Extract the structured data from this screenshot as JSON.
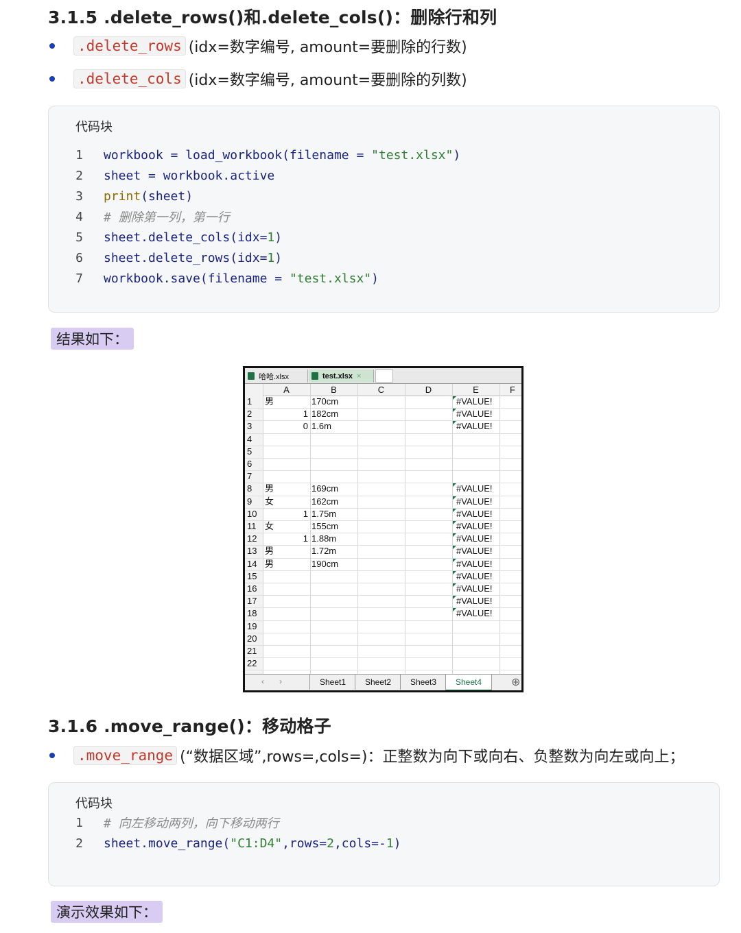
{
  "section1": {
    "heading": "3.1.5 .delete_rows()和.delete_cols()：删除行和列",
    "bullets": [
      {
        "code": ".delete_rows",
        "text": "(idx=数字编号, amount=要删除的行数)"
      },
      {
        "code": ".delete_cols",
        "text": "(idx=数字编号, amount=要删除的列数)"
      }
    ],
    "code_title": "代码块",
    "code_lines": [
      {
        "n": "1",
        "parts": [
          [
            "n",
            "workbook = load_workbook(filename = "
          ],
          [
            "s",
            "\"test.xlsx\""
          ],
          [
            "n",
            ")"
          ]
        ]
      },
      {
        "n": "2",
        "parts": [
          [
            "n",
            "sheet = workbook.active"
          ]
        ]
      },
      {
        "n": "3",
        "parts": [
          [
            "k",
            "print"
          ],
          [
            "n",
            "(sheet)"
          ]
        ]
      },
      {
        "n": "4",
        "parts": [
          [
            "c",
            "# 删除第一列，第一行"
          ]
        ]
      },
      {
        "n": "5",
        "parts": [
          [
            "n",
            "sheet.delete_cols(idx="
          ],
          [
            "s",
            "1"
          ],
          [
            "n",
            ")"
          ]
        ]
      },
      {
        "n": "6",
        "parts": [
          [
            "n",
            "sheet.delete_rows(idx="
          ],
          [
            "s",
            "1"
          ],
          [
            "n",
            ")"
          ]
        ]
      },
      {
        "n": "7",
        "parts": [
          [
            "n",
            "workbook.save(filename = "
          ],
          [
            "s",
            "\"test.xlsx\""
          ],
          [
            "n",
            ")"
          ]
        ]
      }
    ],
    "result_label": "结果如下："
  },
  "excel": {
    "file_tabs": [
      "哈哈.xlsx",
      "test.xlsx"
    ],
    "close_mark": "×",
    "columns": [
      "A",
      "B",
      "C",
      "D",
      "E",
      "F"
    ],
    "rows": [
      {
        "r": "1",
        "a": "男",
        "a_num": "",
        "b": "170cm",
        "e": "#VALUE!"
      },
      {
        "r": "2",
        "a": "",
        "a_num": "1",
        "b": "182cm",
        "e": "#VALUE!"
      },
      {
        "r": "3",
        "a": "",
        "a_num": "0",
        "b": "1.6m",
        "e": "#VALUE!"
      },
      {
        "r": "4",
        "a": "",
        "a_num": "",
        "b": "",
        "e": ""
      },
      {
        "r": "5",
        "a": "",
        "a_num": "",
        "b": "",
        "e": ""
      },
      {
        "r": "6",
        "a": "",
        "a_num": "",
        "b": "",
        "e": ""
      },
      {
        "r": "7",
        "a": "",
        "a_num": "",
        "b": "",
        "e": ""
      },
      {
        "r": "8",
        "a": "男",
        "a_num": "",
        "b": "169cm",
        "e": "#VALUE!"
      },
      {
        "r": "9",
        "a": "女",
        "a_num": "",
        "b": "162cm",
        "e": "#VALUE!"
      },
      {
        "r": "10",
        "a": "",
        "a_num": "1",
        "b": "1.75m",
        "e": "#VALUE!"
      },
      {
        "r": "11",
        "a": "女",
        "a_num": "",
        "b": "155cm",
        "e": "#VALUE!"
      },
      {
        "r": "12",
        "a": "",
        "a_num": "1",
        "b": "1.88m",
        "e": "#VALUE!"
      },
      {
        "r": "13",
        "a": "男",
        "a_num": "",
        "b": "1.72m",
        "e": "#VALUE!"
      },
      {
        "r": "14",
        "a": "男",
        "a_num": "",
        "b": "190cm",
        "e": "#VALUE!"
      },
      {
        "r": "15",
        "a": "",
        "a_num": "",
        "b": "",
        "e": "#VALUE!"
      },
      {
        "r": "16",
        "a": "",
        "a_num": "",
        "b": "",
        "e": "#VALUE!"
      },
      {
        "r": "17",
        "a": "",
        "a_num": "",
        "b": "",
        "e": "#VALUE!"
      },
      {
        "r": "18",
        "a": "",
        "a_num": "",
        "b": "",
        "e": "#VALUE!"
      },
      {
        "r": "19",
        "a": "",
        "a_num": "",
        "b": "",
        "e": ""
      },
      {
        "r": "20",
        "a": "",
        "a_num": "",
        "b": "",
        "e": ""
      },
      {
        "r": "21",
        "a": "",
        "a_num": "",
        "b": "",
        "e": ""
      },
      {
        "r": "22",
        "a": "",
        "a_num": "",
        "b": "",
        "e": ""
      }
    ],
    "nav_prev": "‹",
    "nav_next": "›",
    "sheet_tabs": [
      "Sheet1",
      "Sheet2",
      "Sheet3",
      "Sheet4"
    ],
    "active_sheet": "Sheet4",
    "add_sheet": "⊕"
  },
  "section2": {
    "heading": "3.1.6 .move_range()：移动格子",
    "bullet": {
      "code": ".move_range",
      "text": "(“数据区域”,rows=,cols=)：正整数为向下或向右、负整数为向左或向上；"
    },
    "code_title": "代码块",
    "code_lines": [
      {
        "n": "1",
        "parts": [
          [
            "c",
            "# 向左移动两列，向下移动两行"
          ]
        ]
      },
      {
        "n": "2",
        "parts": [
          [
            "n",
            "sheet.move_range("
          ],
          [
            "s",
            "\"C1:D4\""
          ],
          [
            "n",
            ",rows="
          ],
          [
            "s",
            "2"
          ],
          [
            "n",
            ",cols=-"
          ],
          [
            "s",
            "1"
          ],
          [
            "n",
            ")"
          ]
        ]
      }
    ],
    "demo_label": "演示效果如下："
  },
  "colors": {
    "bullet": "#1a3fb0",
    "inline_code": "#c0392b",
    "tag_bg": "#d9ccf2",
    "code_bg": "#f6f7f8",
    "excel_icon": "#1e7145"
  }
}
